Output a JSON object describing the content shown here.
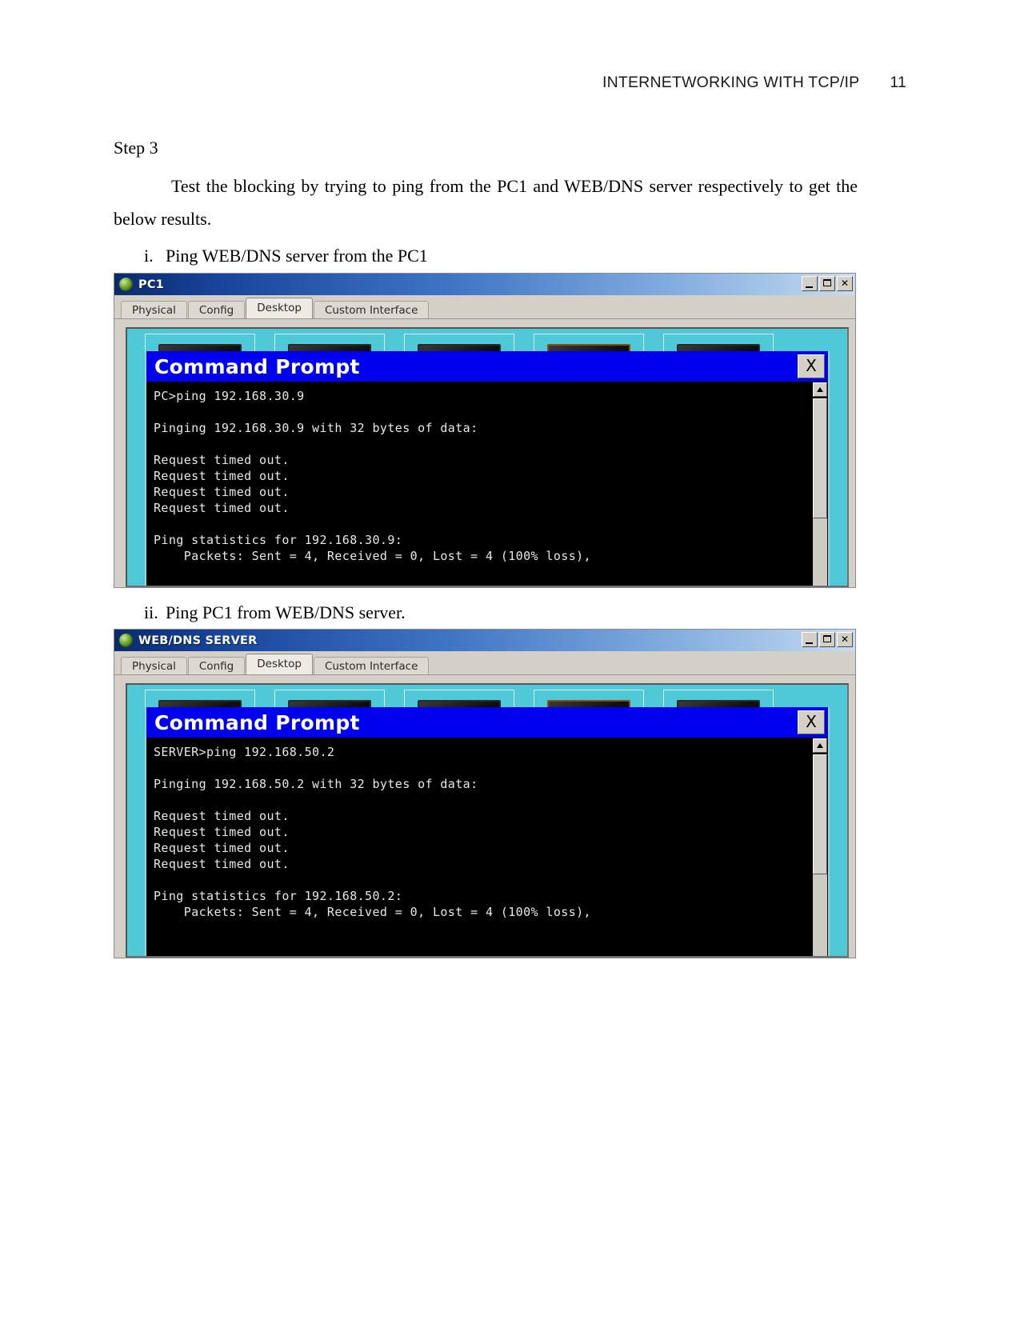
{
  "header": {
    "title": "INTERNETWORKING WITH TCP/IP",
    "page_number": "11"
  },
  "document": {
    "step_label": "Step 3",
    "paragraph": "Test the blocking by trying to ping from the PC1 and WEB/DNS server respectively to get the below results.",
    "items": [
      {
        "marker": "i.",
        "text": "Ping WEB/DNS server from the PC1"
      },
      {
        "marker": "ii.",
        "text": "Ping PC1 from WEB/DNS server."
      }
    ]
  },
  "colors": {
    "titlebar_blue": "#18449c",
    "cmd_titlebar_blue": "#0000ee",
    "desktop_cyan": "#4fc8d8",
    "window_chrome": "#d4d0c8",
    "terminal_bg": "#000000",
    "terminal_fg": "#e8e8e8"
  },
  "windows": [
    {
      "id": "pc1",
      "title": "PC1",
      "tabs": [
        {
          "label": "Physical",
          "active": false
        },
        {
          "label": "Config",
          "active": false
        },
        {
          "label": "Desktop",
          "active": true
        },
        {
          "label": "Custom Interface",
          "active": false
        }
      ],
      "controls": {
        "minimize": "_",
        "maximize": "□",
        "close": "✕"
      },
      "command_prompt": {
        "title": "Command Prompt",
        "close_label": "X",
        "output": "PC>ping 192.168.30.9\n\nPinging 192.168.30.9 with 32 bytes of data:\n\nRequest timed out.\nRequest timed out.\nRequest timed out.\nRequest timed out.\n\nPing statistics for 192.168.30.9:\n    Packets: Sent = 4, Received = 0, Lost = 4 (100% loss),"
      }
    },
    {
      "id": "web-dns-server",
      "title": "WEB/DNS SERVER",
      "tabs": [
        {
          "label": "Physical",
          "active": false
        },
        {
          "label": "Config",
          "active": false
        },
        {
          "label": "Desktop",
          "active": true
        },
        {
          "label": "Custom Interface",
          "active": false
        }
      ],
      "controls": {
        "minimize": "_",
        "maximize": "□",
        "close": "✕"
      },
      "command_prompt": {
        "title": "Command Prompt",
        "close_label": "X",
        "output": "SERVER>ping 192.168.50.2\n\nPinging 192.168.50.2 with 32 bytes of data:\n\nRequest timed out.\nRequest timed out.\nRequest timed out.\nRequest timed out.\n\nPing statistics for 192.168.50.2:\n    Packets: Sent = 4, Received = 0, Lost = 4 (100% loss),"
      }
    }
  ]
}
